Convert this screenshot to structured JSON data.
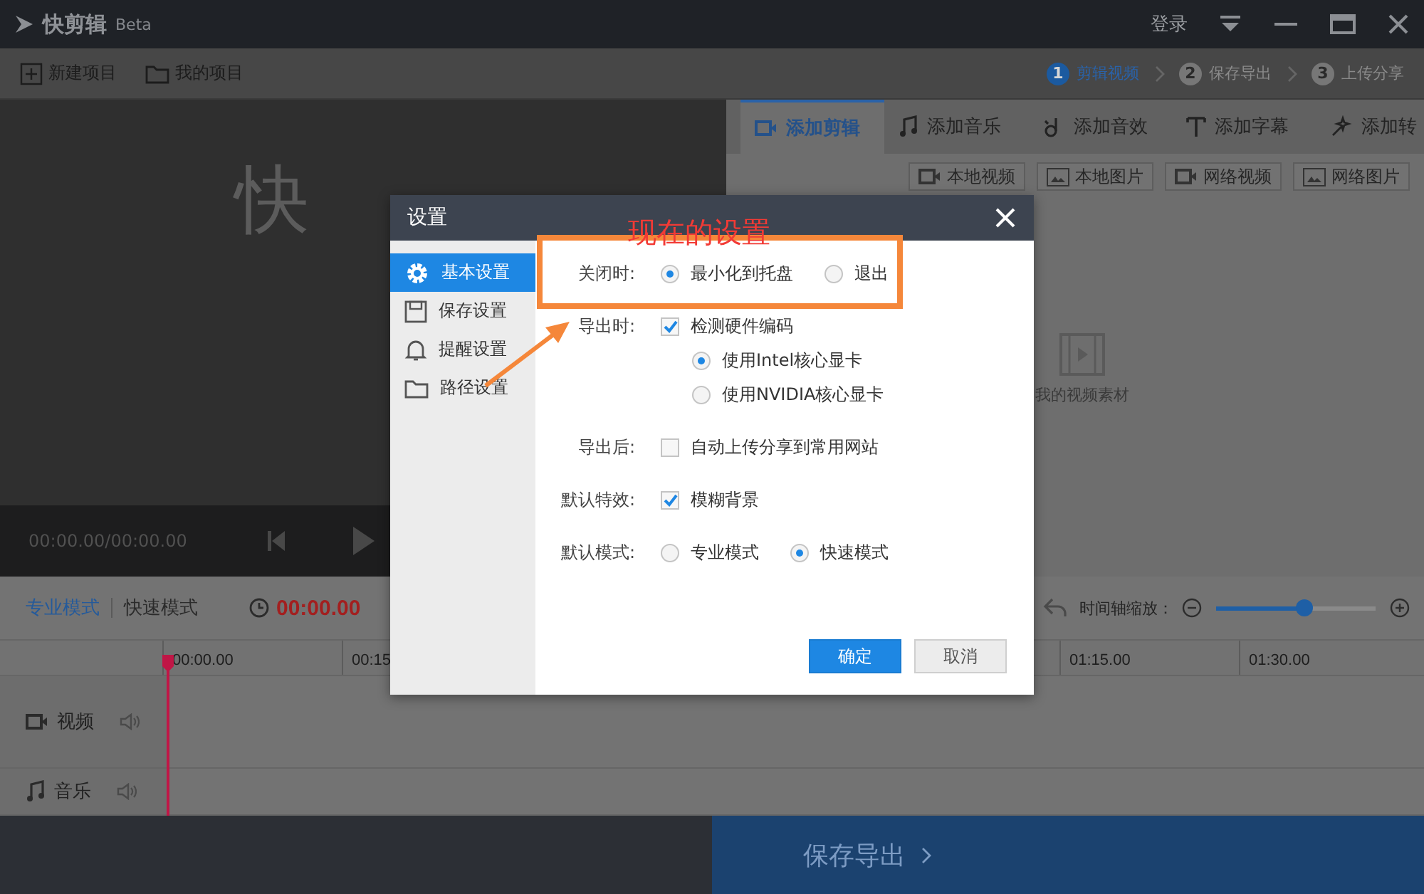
{
  "window": {
    "logo_text": "快剪辑",
    "badge": "Beta",
    "login": "登录"
  },
  "toolbar": {
    "buttons": [
      "新建项目",
      "我的项目"
    ],
    "steps": [
      {
        "number": "1",
        "label": "剪辑视频",
        "selected": true
      },
      {
        "number": "2",
        "label": "保存导出",
        "selected": false
      },
      {
        "number": "3",
        "label": "上传分享",
        "selected": false
      }
    ]
  },
  "preview": {
    "logo_text": "快",
    "time": "00:00.00/00:00.00"
  },
  "media_panel": {
    "tabs": [
      {
        "label": "添加剪辑",
        "selected": true
      },
      {
        "label": "添加音乐",
        "selected": false
      },
      {
        "label": "添加音效",
        "selected": false
      },
      {
        "label": "添加字幕",
        "selected": false
      },
      {
        "label": "添加转",
        "selected": false
      }
    ],
    "sources": [
      "本地视频",
      "本地图片",
      "网络视频",
      "网络图片"
    ],
    "empty_label": "我的视频素材"
  },
  "timeline": {
    "modes": [
      {
        "label": "专业模式",
        "selected": true
      },
      {
        "label": "快速模式",
        "selected": false
      }
    ],
    "current_time": "00:00.00",
    "zoom_label": "时间轴缩放：",
    "zoom": {
      "level": 0.55
    },
    "ticks_left": [
      "00:00.00",
      "00:15"
    ],
    "ticks_right": [
      "01:15.00",
      "01:30.00"
    ],
    "tracks": [
      {
        "label": "视频",
        "kind": "video"
      },
      {
        "label": "音乐",
        "kind": "music"
      }
    ]
  },
  "export_button": "保存导出",
  "dialog": {
    "title": "设置",
    "nav": [
      {
        "label": "基本设置",
        "selected": true
      },
      {
        "label": "保存设置",
        "selected": false
      },
      {
        "label": "提醒设置",
        "selected": false
      },
      {
        "label": "路径设置",
        "selected": false
      }
    ],
    "rows": [
      {
        "label": "关闭时:",
        "kind": "radios",
        "options": [
          {
            "label": "最小化到托盘",
            "selected": true
          },
          {
            "label": "退出",
            "selected": false
          }
        ]
      },
      {
        "label": "导出时:",
        "kind": "checkbox",
        "text": "检测硬件编码",
        "checked": true,
        "sub_options": [
          {
            "label": "使用Intel核心显卡",
            "selected": true
          },
          {
            "label": "使用NVIDIA核心显卡",
            "selected": false
          }
        ]
      },
      {
        "label": "导出后:",
        "kind": "checkbox",
        "text": "自动上传分享到常用网站",
        "checked": false
      },
      {
        "label": "默认特效:",
        "kind": "checkbox",
        "text": "模糊背景",
        "checked": true
      },
      {
        "label": "默认模式:",
        "kind": "radios",
        "options": [
          {
            "label": "专业模式",
            "selected": false
          },
          {
            "label": "快速模式",
            "selected": true
          }
        ]
      }
    ],
    "buttons": [
      {
        "label": "确定",
        "kind": "primary"
      },
      {
        "label": "取消",
        "kind": "default"
      }
    ]
  },
  "annotation": {
    "text": "现在的设置"
  }
}
